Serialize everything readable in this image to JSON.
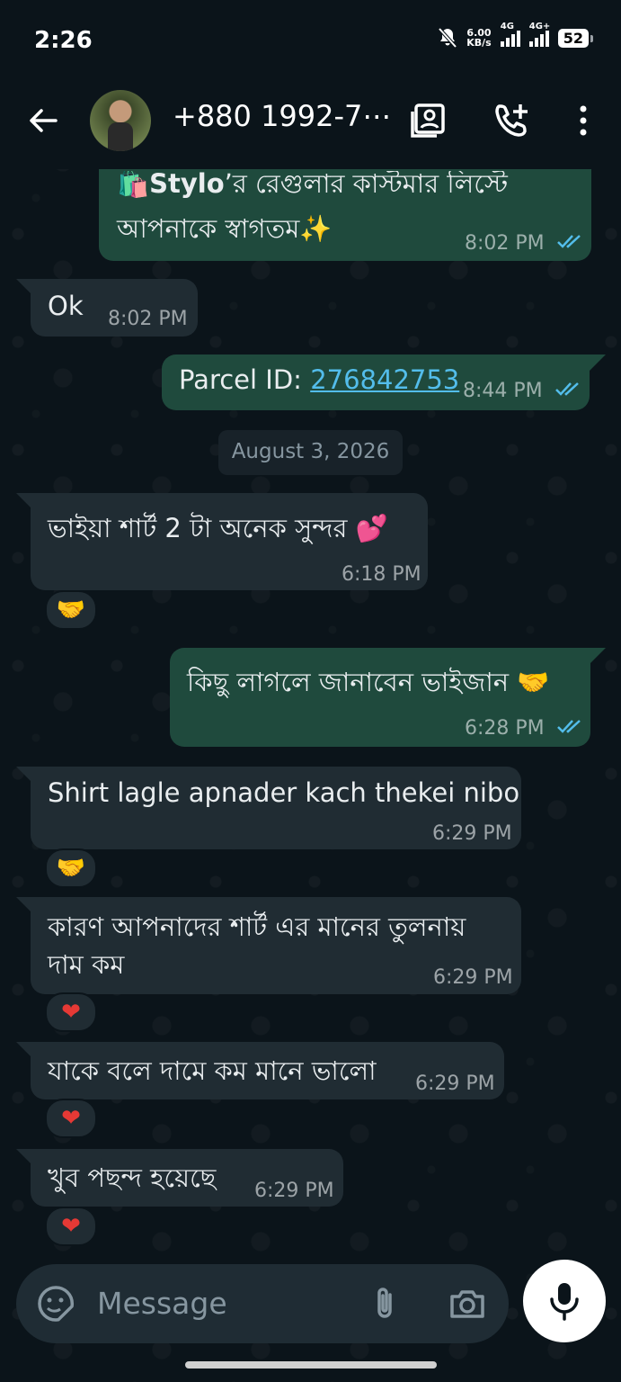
{
  "status_bar": {
    "time": "2:26",
    "net_speed_value": "6.00",
    "net_speed_unit": "KB/s",
    "sim1": "4G",
    "sim2": "4G+",
    "battery": "52"
  },
  "header": {
    "contact": "+880 1992-7⋯",
    "icons": [
      "back-arrow-icon",
      "contact-card-icon",
      "add-call-icon",
      "more-vert-icon"
    ]
  },
  "messages": [
    {
      "dir": "out",
      "line1_brand": "Stylo",
      "line1_rest": "’র রেগুলার কাস্টমার লিস্টে",
      "line2": "আপনাকে স্বাগতম✨",
      "time": "8:02 PM"
    },
    {
      "dir": "in",
      "text": "Ok",
      "time": "8:02 PM"
    },
    {
      "dir": "out",
      "prefix": "Parcel ID: ",
      "link": "276842753",
      "time": "8:44 PM"
    },
    {
      "dir": "in",
      "text": "ভাইয়া শার্ট 2 টা অনেক সুন্দর 💕",
      "time": "6:18 PM",
      "reaction": "🤝"
    },
    {
      "dir": "out",
      "text": "কিছু লাগলে জানাবেন ভাইজান 🤝",
      "time": "6:28 PM"
    },
    {
      "dir": "in",
      "text": "Shirt lagle apnader kach thekei nibo",
      "time": "6:29 PM",
      "reaction": "🤝"
    },
    {
      "dir": "in",
      "line1": "কারণ আপনাদের শার্ট এর মানের তুলনায়",
      "line2": "দাম কম",
      "time": "6:29 PM",
      "reaction": "❤"
    },
    {
      "dir": "in",
      "text": "যাকে বলে দামে কম মানে ভালো",
      "time": "6:29 PM",
      "reaction": "❤"
    },
    {
      "dir": "in",
      "text": "খুব পছন্দ হয়েছে",
      "time": "6:29 PM",
      "reaction": "❤"
    }
  ],
  "date_separator": "August 3, 2026",
  "input": {
    "placeholder": "Message",
    "icons": [
      "sticker-icon",
      "attach-icon",
      "camera-icon",
      "mic-icon"
    ]
  },
  "colors": {
    "background": "#0b141a",
    "incoming_bubble": "#202c33",
    "outgoing_bubble": "#1f4a3d",
    "link": "#53bdeb",
    "read_ticks": "#53bdeb"
  }
}
